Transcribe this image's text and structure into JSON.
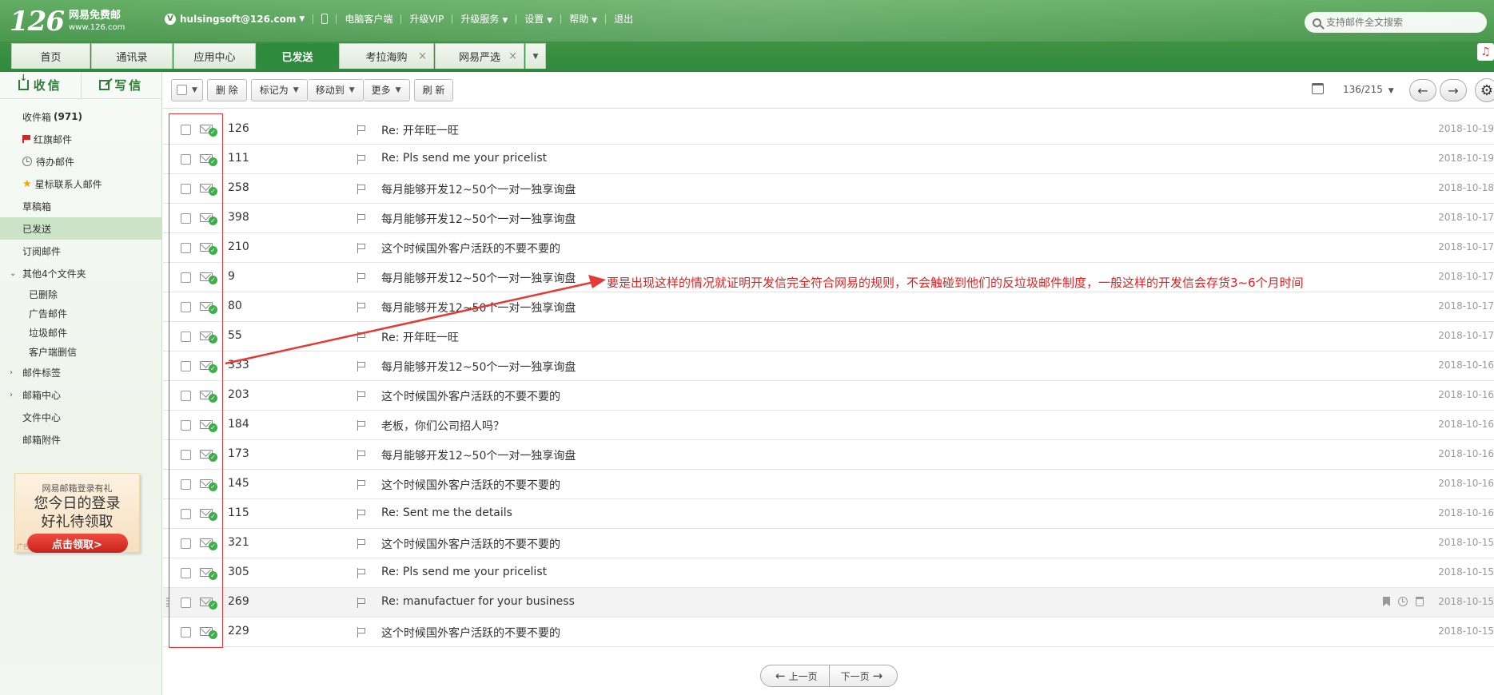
{
  "header": {
    "logo_number": "126",
    "logo_title": "网易免费邮",
    "logo_url_text": "www.126.com",
    "account_badge": "V",
    "account_email": "hulsingsoft@126.com",
    "nav": [
      "电脑客户端",
      "升级VIP",
      "升级服务",
      "设置",
      "帮助",
      "退出"
    ],
    "search_placeholder": "支持邮件全文搜索"
  },
  "tabs": [
    {
      "label": "首页"
    },
    {
      "label": "通讯录"
    },
    {
      "label": "应用中心"
    },
    {
      "label": "已发送"
    },
    {
      "label": "考拉海购"
    },
    {
      "label": "网易严选"
    }
  ],
  "sidebar": {
    "receive_label": "收信",
    "compose_label": "写信",
    "inbox_label": "收件箱",
    "inbox_count": "(971)",
    "folders": [
      "红旗邮件",
      "待办邮件",
      "星标联系人邮件",
      "草稿箱",
      "已发送",
      "订阅邮件",
      "其他4个文件夹",
      "已删除",
      "广告邮件",
      "垃圾邮件",
      "客户端删信",
      "邮件标签",
      "邮箱中心",
      "文件中心",
      "邮箱附件"
    ],
    "promo": {
      "line1": "网易邮箱登录有礼",
      "line2": "您今日的登录",
      "line3": "好礼待领取",
      "button": "点击领取>",
      "ad_tag": "广告"
    }
  },
  "toolbar": {
    "delete": "删 除",
    "mark_as": "标记为",
    "move_to": "移动到",
    "more": "更多",
    "refresh": "刷 新",
    "page_indicator": "136/215"
  },
  "emails": [
    {
      "sender": "126",
      "subject": "Re: 开年旺一旺",
      "date": "2018-10-19"
    },
    {
      "sender": "111",
      "subject": "Re: Pls send me your pricelist",
      "date": "2018-10-19"
    },
    {
      "sender": "258",
      "subject": "每月能够开发12~50个一对一独享询盘",
      "date": "2018-10-18"
    },
    {
      "sender": "398",
      "subject": "每月能够开发12~50个一对一独享询盘",
      "date": "2018-10-17"
    },
    {
      "sender": "210",
      "subject": "这个时候国外客户活跃的不要不要的",
      "date": "2018-10-17"
    },
    {
      "sender": "9",
      "subject": "每月能够开发12~50个一对一独享询盘",
      "date": "2018-10-17"
    },
    {
      "sender": "80",
      "subject": "每月能够开发12~50个一对一独享询盘",
      "date": "2018-10-17"
    },
    {
      "sender": "55",
      "subject": "Re: 开年旺一旺",
      "date": "2018-10-17"
    },
    {
      "sender": "333",
      "subject": "每月能够开发12~50个一对一独享询盘",
      "date": "2018-10-16"
    },
    {
      "sender": "203",
      "subject": "这个时候国外客户活跃的不要不要的",
      "date": "2018-10-16"
    },
    {
      "sender": "184",
      "subject": "老板，你们公司招人吗？",
      "date": "2018-10-16"
    },
    {
      "sender": "173",
      "subject": "每月能够开发12~50个一对一独享询盘",
      "date": "2018-10-16"
    },
    {
      "sender": "145",
      "subject": "这个时候国外客户活跃的不要不要的",
      "date": "2018-10-16"
    },
    {
      "sender": "115",
      "subject": "Re: Sent me the details",
      "date": "2018-10-16"
    },
    {
      "sender": "321",
      "subject": "这个时候国外客户活跃的不要不要的",
      "date": "2018-10-15"
    },
    {
      "sender": "305",
      "subject": "Re: Pls send me your pricelist",
      "date": "2018-10-15"
    },
    {
      "sender": "269",
      "subject": "Re: manufactuer for your business",
      "date": "2018-10-15"
    },
    {
      "sender": "229",
      "subject": "这个时候国外客户活跃的不要不要的",
      "date": "2018-10-15"
    }
  ],
  "annotation_text": "要是出现这样的情况就证明开发信完全符合网易的规则，不会触碰到他们的反垃圾邮件制度，一般这样的开发信会存货3~6个月时间",
  "pager": {
    "prev": "上一页",
    "next": "下一页"
  },
  "colors": {
    "brand_green": "#3f9144",
    "active_tab": "#2e8a3c",
    "annotation_red": "#e02020"
  },
  "icons": [
    "search-icon",
    "phone-icon",
    "receive-icon",
    "compose-icon",
    "red-flag-icon",
    "clock-icon",
    "star-icon",
    "calendar-icon",
    "settings-icon",
    "envelope-sent-icon",
    "flag-icon",
    "bookmark-icon",
    "trash-icon",
    "music-icon"
  ]
}
